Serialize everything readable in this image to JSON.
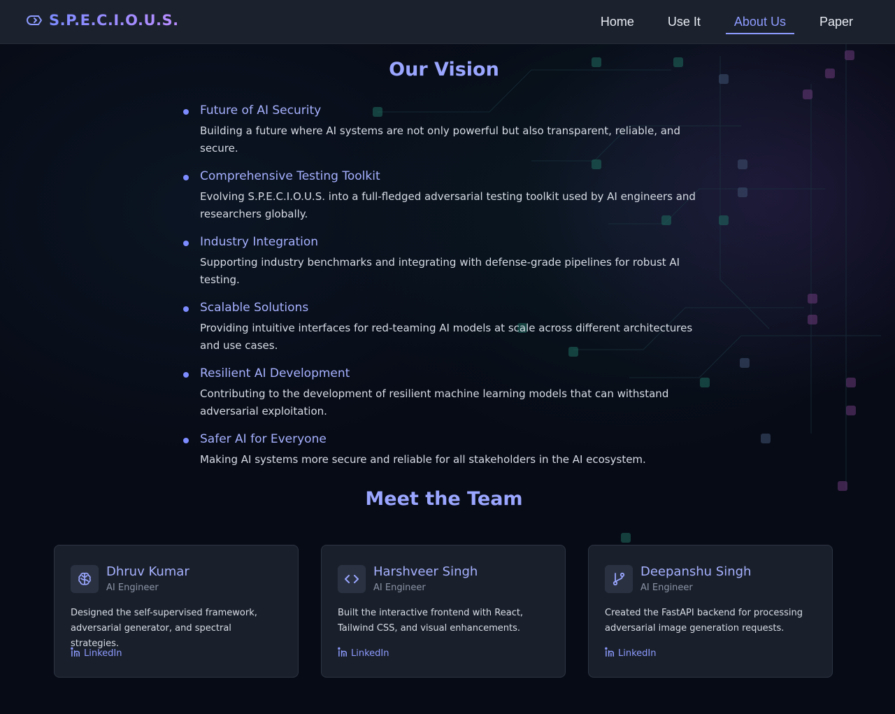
{
  "header": {
    "brand": "S.P.E.C.I.O.U.S.",
    "brand_icon": "tag-icon",
    "nav": [
      {
        "label": "Home",
        "active": false
      },
      {
        "label": "Use It",
        "active": false
      },
      {
        "label": "About Us",
        "active": true
      },
      {
        "label": "Paper",
        "active": false
      }
    ]
  },
  "vision": {
    "title": "Our Vision",
    "items": [
      {
        "title": "Future of AI Security",
        "text": "Building a future where AI systems are not only powerful but also transparent, reliable, and secure."
      },
      {
        "title": "Comprehensive Testing Toolkit",
        "text": "Evolving S.P.E.C.I.O.U.S. into a full-fledged adversarial testing toolkit used by AI engineers and researchers globally."
      },
      {
        "title": "Industry Integration",
        "text": "Supporting industry benchmarks and integrating with defense-grade pipelines for robust AI testing."
      },
      {
        "title": "Scalable Solutions",
        "text": "Providing intuitive interfaces for red-teaming AI models at scale across different architectures and use cases."
      },
      {
        "title": "Resilient AI Development",
        "text": "Contributing to the development of resilient machine learning models that can withstand adversarial exploitation."
      },
      {
        "title": "Safer AI for Everyone",
        "text": "Making AI systems more secure and reliable for all stakeholders in the AI ecosystem."
      }
    ]
  },
  "team": {
    "title": "Meet the Team",
    "members": [
      {
        "name": "Dhruv Kumar",
        "role": "AI Engineer",
        "icon": "brain-icon",
        "description": "Designed the self-supervised framework, adversarial generator, and spectral strategies.",
        "link_label": "LinkedIn"
      },
      {
        "name": "Harshveer Singh",
        "role": "AI Engineer",
        "icon": "code-icon",
        "description": "Built the interactive frontend with React, Tailwind CSS, and visual enhancements.",
        "link_label": "LinkedIn"
      },
      {
        "name": "Deepanshu Singh",
        "role": "AI Engineer",
        "icon": "git-branch-icon",
        "description": "Created the FastAPI backend for processing adversarial image generation requests.",
        "link_label": "LinkedIn"
      }
    ]
  },
  "colors": {
    "accent": "#8d9bff",
    "background": "#070b16",
    "card": "#1a202b",
    "header": "#1c222d"
  }
}
